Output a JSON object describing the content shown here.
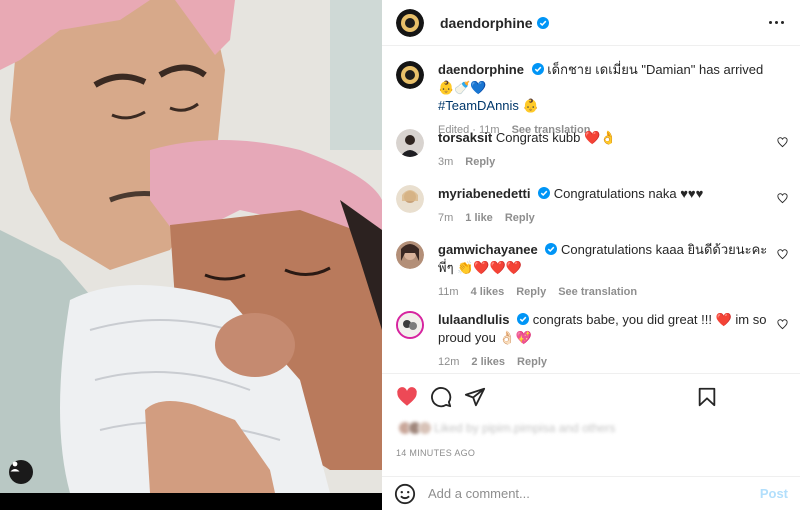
{
  "post": {
    "username": "daendorphine",
    "caption": {
      "username": "daendorphine",
      "text": "เด็กชาย เดเมี่ยน \"Damian\" has arrived 👶🍼💙",
      "hashtag": "#TeamDAnnis",
      "emoji": "👶",
      "edited": "Edited · 11m",
      "see_translation": "See translation"
    },
    "comments": [
      {
        "username": "torsaksit",
        "text": "Congrats kubb",
        "emoji": "❤️👌",
        "time": "3m",
        "likes": "",
        "reply": "Reply",
        "see_translation": ""
      },
      {
        "username": "myriabenedetti",
        "text": "Congratulations naka ♥♥♥",
        "emoji": "",
        "time": "7m",
        "likes": "1 like",
        "reply": "Reply",
        "see_translation": ""
      },
      {
        "username": "gamwichayanee",
        "text": "Congratulations kaaa ยินดีด้วยนะคะพี่ๆ",
        "emoji": "👏❤️❤️❤️",
        "time": "11m",
        "likes": "4 likes",
        "reply": "Reply",
        "see_translation": "See translation"
      },
      {
        "username": "lulaandlulis",
        "text": "congrats babe, you did great !!!",
        "emoji": "❤️ im so proud you 👌🏻💖",
        "time": "12m",
        "likes": "2 likes",
        "reply": "Reply",
        "see_translation": ""
      }
    ],
    "liked_by": "Liked by pipim.pimpisa and others",
    "timestamp": "14 MINUTES AGO",
    "add_comment_placeholder": "Add a comment...",
    "post_button": "Post"
  },
  "icons": {
    "verified": "verified-badge-icon",
    "more": "more-options-icon",
    "like": "heart-filled-icon",
    "comment": "comment-bubble-icon",
    "share": "paper-plane-icon",
    "save": "bookmark-icon",
    "emoji": "smiley-icon",
    "tag": "person-tag-icon"
  },
  "colors": {
    "like_red": "#ed4956",
    "verified_blue": "#0095f6",
    "hashtag": "#00376b",
    "muted": "#8e8e8e",
    "post_disabled": "#b2dffc"
  }
}
